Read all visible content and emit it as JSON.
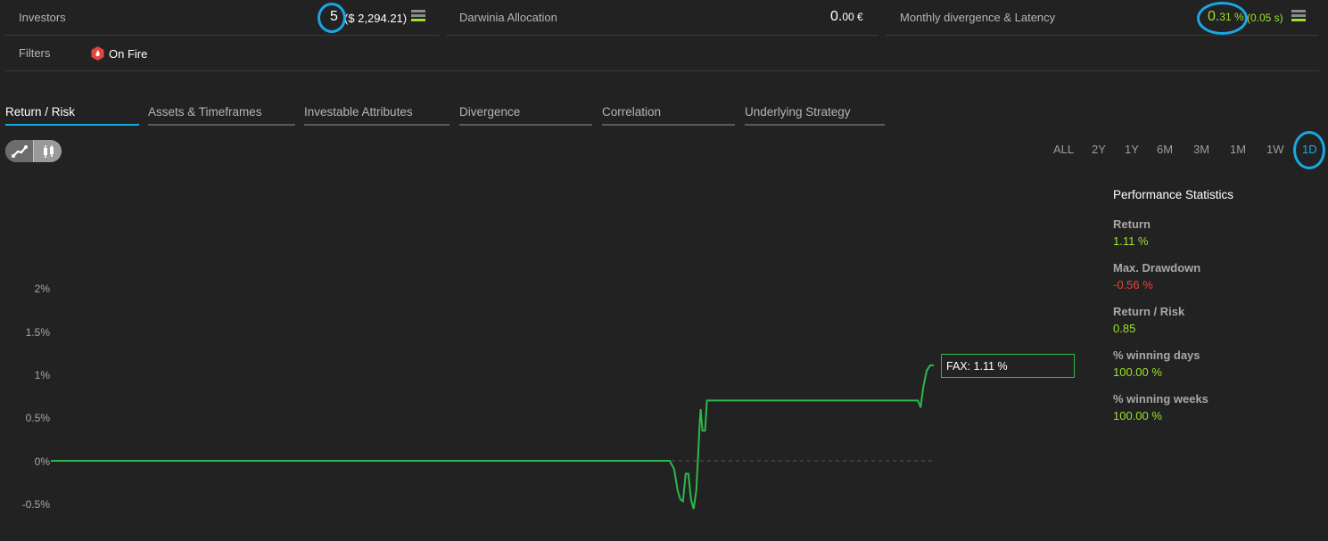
{
  "header": {
    "investors": {
      "label": "Investors",
      "count": "5",
      "amount": "($ 2,294.21)"
    },
    "allocation": {
      "label": "Darwinia Allocation",
      "value_main": "0.",
      "value_small": "00 €"
    },
    "divergence": {
      "label": "Monthly divergence & Latency",
      "value_main": "0.",
      "value_small": "31 %",
      "latency": "(0.05 s)"
    },
    "filters": {
      "label": "Filters",
      "badge": "On Fire"
    }
  },
  "tabs": [
    {
      "label": "Return / Risk",
      "active": true
    },
    {
      "label": "Assets & Timeframes",
      "active": false
    },
    {
      "label": "Investable Attributes",
      "active": false
    },
    {
      "label": "Divergence",
      "active": false
    },
    {
      "label": "Correlation",
      "active": false
    },
    {
      "label": "Underlying Strategy",
      "active": false
    }
  ],
  "chart_toggle": {
    "options": [
      "line-chart-icon",
      "candlestick-icon"
    ],
    "selected": "line-chart-icon"
  },
  "ranges": [
    {
      "label": "ALL"
    },
    {
      "label": "2Y"
    },
    {
      "label": "1Y"
    },
    {
      "label": "6M"
    },
    {
      "label": "3M"
    },
    {
      "label": "1M"
    },
    {
      "label": "1W"
    },
    {
      "label": "1D",
      "selected": true
    }
  ],
  "stats": {
    "title": "Performance Statistics",
    "items": [
      {
        "label": "Return",
        "value": "1.11 %",
        "tone": "green"
      },
      {
        "label": "Max. Drawdown",
        "value": "-0.56 %",
        "tone": "red"
      },
      {
        "label": "Return / Risk",
        "value": "0.85",
        "tone": "green"
      },
      {
        "label": "% winning days",
        "value": "100.00 %",
        "tone": "green"
      },
      {
        "label": "% winning weeks",
        "value": "100.00 %",
        "tone": "green"
      }
    ]
  },
  "colors": {
    "accent": "#18a8e4",
    "positive": "#9be12a",
    "negative": "#f0403c",
    "series": "#2db84d"
  },
  "chart_data": {
    "type": "line",
    "yticks": [
      "2%",
      "1.5%",
      "1%",
      "0.5%",
      "0%",
      "-0.5%"
    ],
    "ylim": [
      -0.6,
      2.2
    ],
    "xlim": [
      0,
      100
    ],
    "grid": false,
    "tooltip": "FAX: 1.11 %",
    "series": [
      {
        "points": [
          [
            0,
            0
          ],
          [
            70.1,
            0
          ],
          [
            70.6,
            -0.1
          ],
          [
            71.0,
            -0.35
          ],
          [
            71.3,
            -0.45
          ],
          [
            71.6,
            -0.47
          ],
          [
            71.9,
            -0.15
          ],
          [
            72.2,
            -0.15
          ],
          [
            72.5,
            -0.45
          ],
          [
            72.8,
            -0.56
          ],
          [
            73.1,
            -0.35
          ],
          [
            73.3,
            0.05
          ],
          [
            73.5,
            0.45
          ],
          [
            73.6,
            0.6
          ],
          [
            73.8,
            0.35
          ],
          [
            74.1,
            0.35
          ],
          [
            74.3,
            0.7
          ],
          [
            74.8,
            0.7
          ],
          [
            98.2,
            0.7
          ],
          [
            98.5,
            0.62
          ],
          [
            98.8,
            0.85
          ],
          [
            99.2,
            1.05
          ],
          [
            99.6,
            1.11
          ],
          [
            100,
            1.11
          ]
        ]
      }
    ]
  }
}
